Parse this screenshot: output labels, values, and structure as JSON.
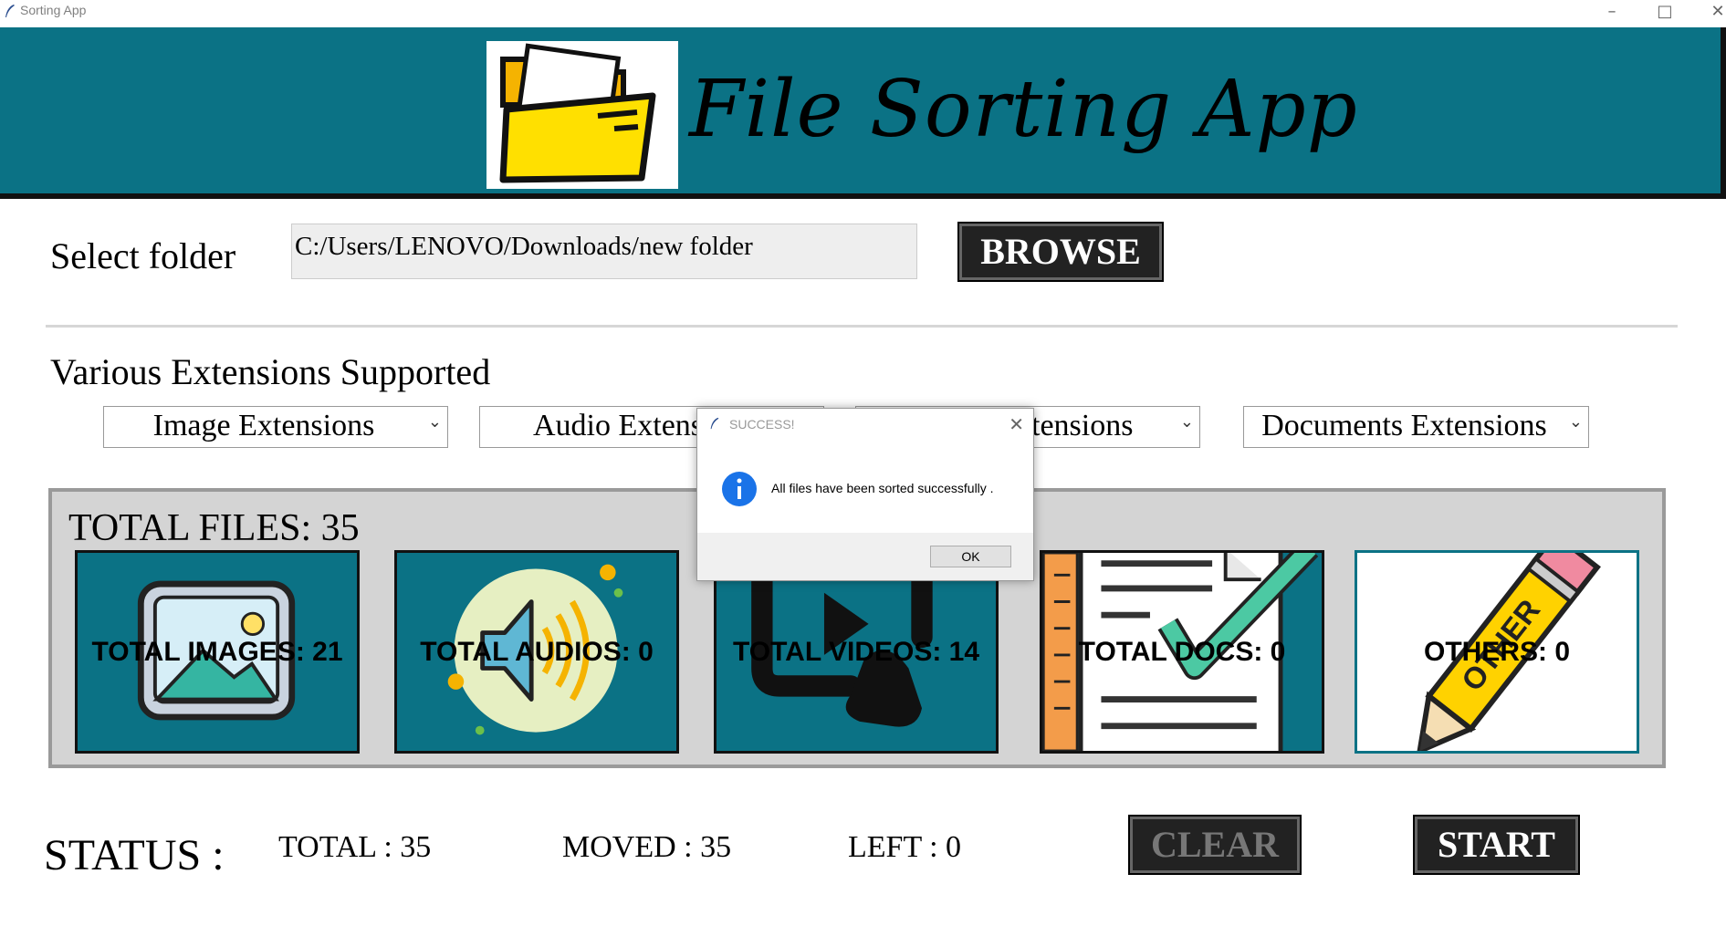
{
  "window": {
    "title": "Sorting App"
  },
  "header": {
    "title": "File Sorting App"
  },
  "folder": {
    "label": "Select folder",
    "path": "C:/Users/LENOVO/Downloads/new folder",
    "browse_label": "BROWSE"
  },
  "extensions": {
    "heading": "Various Extensions Supported",
    "combos": [
      "Image Extensions",
      "Audio Extens",
      "tensions",
      "Documents Extensions"
    ]
  },
  "totals": {
    "total_files": "TOTAL FILES: 35",
    "tiles": [
      "TOTAL IMAGES: 21",
      "TOTAL AUDIOS: 0",
      "TOTAL VIDEOS: 14",
      "TOTAL DOCS: 0",
      "OTHERS: 0"
    ]
  },
  "status": {
    "label": "STATUS :",
    "total": "TOTAL : 35",
    "moved": "MOVED : 35",
    "left": "LEFT : 0",
    "clear_label": "CLEAR",
    "start_label": "START"
  },
  "dialog": {
    "title": "SUCCESS!",
    "message": "All files have been sorted successfully .",
    "ok_label": "OK"
  }
}
